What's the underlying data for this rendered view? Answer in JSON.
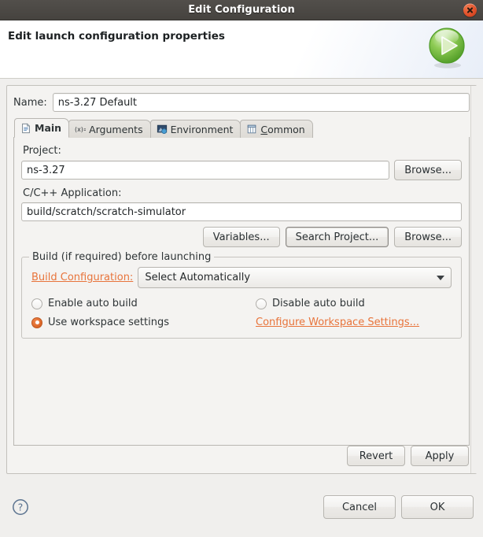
{
  "window": {
    "title": "Edit Configuration",
    "close_icon": "close-icon"
  },
  "header": {
    "title": "Edit launch configuration properties",
    "icon": "run-play-icon"
  },
  "name_row": {
    "label": "Name:",
    "value": "ns-3.27 Default"
  },
  "tabs": [
    {
      "label": "Main",
      "icon": "document-icon",
      "selected": true
    },
    {
      "label": "Arguments",
      "icon": "variable-icon",
      "selected": false
    },
    {
      "label": "Environment",
      "icon": "environment-icon",
      "selected": false
    },
    {
      "label": "Common",
      "icon": "table-icon",
      "selected": false,
      "mnemonic": "C",
      "rest": "ommon"
    }
  ],
  "main_tab": {
    "project_label": "Project:",
    "project_value": "ns-3.27",
    "project_browse_label": "Browse...",
    "application_label": "C/C++ Application:",
    "application_value": "build/scratch/scratch-simulator",
    "variables_label": "Variables...",
    "search_project_label": "Search Project...",
    "app_browse_label": "Browse...",
    "build_group": {
      "title": "Build (if required) before launching",
      "build_config_link": "Build Configuration:",
      "build_config_value": "Select Automatically",
      "radios": [
        {
          "label": "Enable auto build",
          "checked": false
        },
        {
          "label": "Disable auto build",
          "checked": false
        },
        {
          "label": "Use workspace settings",
          "checked": true
        }
      ],
      "configure_workspace_link": "Configure Workspace Settings..."
    }
  },
  "action_buttons": {
    "revert": "Revert",
    "apply": "Apply"
  },
  "footer": {
    "help_icon": "help-icon",
    "cancel": "Cancel",
    "ok": "OK"
  },
  "colors": {
    "titlebar": "#4a4743",
    "link": "#e8743b",
    "accent_radio": "#d4651f",
    "close_button": "#e2502a",
    "run_icon_green": "#76c043",
    "panel_bg": "#f4f3f1"
  }
}
